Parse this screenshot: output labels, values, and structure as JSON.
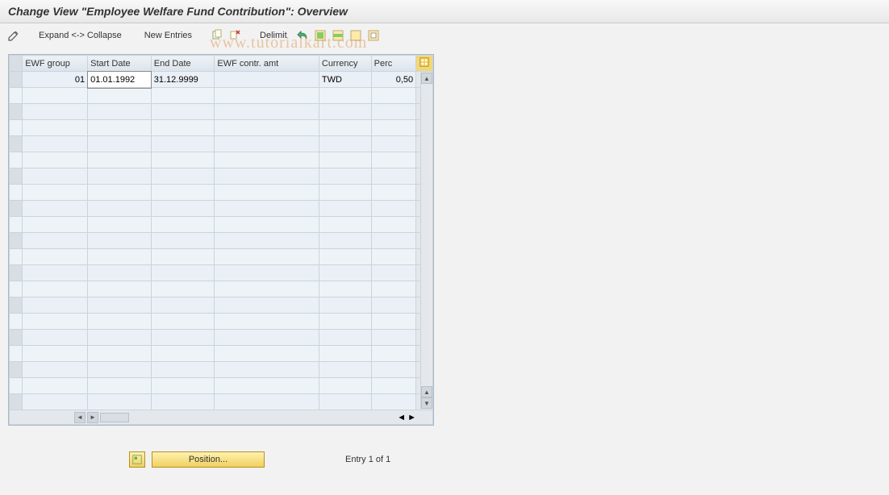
{
  "title": "Change View \"Employee Welfare Fund Contribution\": Overview",
  "toolbar": {
    "expand_collapse": "Expand <-> Collapse",
    "new_entries": "New Entries",
    "delimit": "Delimit",
    "icons": {
      "pencil": "pencil-icon",
      "copy": "copy-icon",
      "delete": "delete-icon",
      "undo": "undo-icon",
      "select_all": "select-all-icon",
      "select_block": "select-block-icon",
      "deselect": "deselect-icon",
      "print": "print-icon"
    }
  },
  "watermark": "www.tutorialkart.com",
  "table": {
    "headers": {
      "ewf_group": "EWF group",
      "start_date": "Start Date",
      "end_date": "End Date",
      "ewf_amt": "EWF contr. amt",
      "currency": "Currency",
      "perc": "Perc"
    },
    "rows": [
      {
        "ewf_group": "01",
        "start_date": "01.01.1992",
        "end_date": "31.12.9999",
        "ewf_amt": "",
        "currency": "TWD",
        "perc": "0,50"
      }
    ],
    "config_icon": "table-settings-icon"
  },
  "footer": {
    "position_button": "Position...",
    "entry_text": "Entry 1 of 1"
  }
}
